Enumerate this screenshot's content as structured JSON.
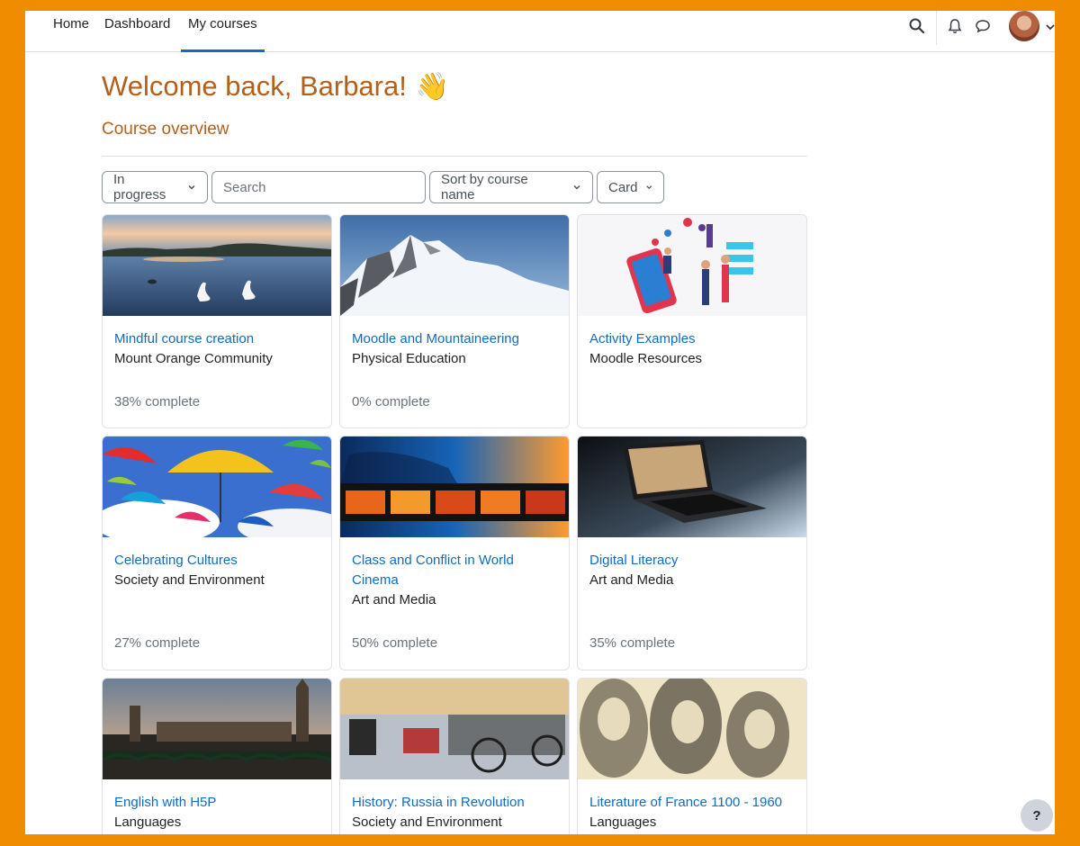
{
  "nav": {
    "home": "Home",
    "dashboard": "Dashboard",
    "my_courses": "My courses"
  },
  "header": {
    "welcome": "Welcome back, Barbara!",
    "wave_emoji": "👋",
    "section_title": "Course overview"
  },
  "filters": {
    "grouping": "In progress",
    "search_placeholder": "Search",
    "sort": "Sort by course name",
    "view": "Card"
  },
  "courses": [
    {
      "title": "Mindful course creation",
      "category": "Mount Orange Community",
      "progress": "38% complete",
      "image": "lake-swans-sunset"
    },
    {
      "title": "Moodle and Mountaineering",
      "category": "Physical Education",
      "progress": "0% complete",
      "image": "snowy-mountain"
    },
    {
      "title": "Activity Examples",
      "category": "Moodle Resources",
      "progress": "",
      "image": "digital-marketing-illustration"
    },
    {
      "title": "Celebrating Cultures",
      "category": "Society and Environment",
      "progress": "27% complete",
      "image": "colorful-umbrellas"
    },
    {
      "title": "Class and Conflict in World Cinema",
      "category": "Art and Media",
      "progress": "50% complete",
      "image": "film-strip"
    },
    {
      "title": "Digital Literacy",
      "category": "Art and Media",
      "progress": "35% complete",
      "image": "laptop-bookshelf"
    },
    {
      "title": "English with H5P",
      "category": "Languages",
      "progress": "",
      "image": "london-westminster"
    },
    {
      "title": "History: Russia in Revolution",
      "category": "Society and Environment",
      "progress": "",
      "image": "horse-carriages-square"
    },
    {
      "title": "Literature of France 1100 - 1960",
      "category": "Languages",
      "progress": "",
      "image": "french-authors-engraving"
    }
  ],
  "help_button": "?",
  "colors": {
    "frame": "#ef8c00",
    "heading": "#b5601a",
    "link": "#0f6cbf",
    "muted": "#6a737b"
  }
}
